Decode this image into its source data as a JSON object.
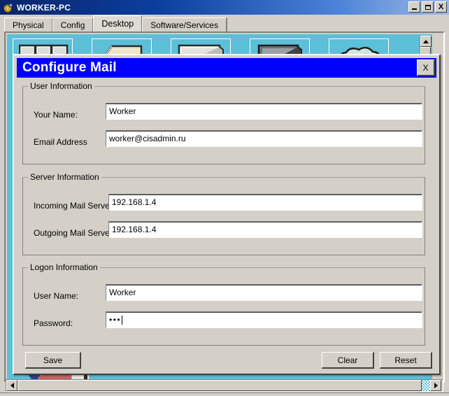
{
  "window": {
    "title": "WORKER-PC",
    "icon": "packet-tracer-device-icon",
    "controls": {
      "minimize": "_",
      "maximize": "□",
      "close": "X"
    }
  },
  "tabs": [
    {
      "label": "Physical",
      "active": false
    },
    {
      "label": "Config",
      "active": false
    },
    {
      "label": "Desktop",
      "active": true
    },
    {
      "label": "Software/Services",
      "active": false
    }
  ],
  "desktop": {
    "background_color": "#5bc0d8",
    "icons": [
      {
        "name": "ip-configuration-icon"
      },
      {
        "name": "dial-up-icon"
      },
      {
        "name": "terminal-icon"
      },
      {
        "name": "command-prompt-icon"
      },
      {
        "name": "web-browser-icon"
      }
    ]
  },
  "dialog": {
    "title": "Configure Mail",
    "title_bg": "#0000ff",
    "close_label": "X",
    "groups": [
      {
        "legend": "User Information",
        "fields": [
          {
            "label": "Your Name:",
            "value": "Worker",
            "type": "text",
            "name": "your-name"
          },
          {
            "label": "Email Address",
            "value": "worker@cisadmin.ru",
            "type": "text",
            "name": "email-address"
          }
        ]
      },
      {
        "legend": "Server Information",
        "fields": [
          {
            "label": "Incoming Mail Server",
            "value": "192.168.1.4",
            "type": "text",
            "name": "incoming-mail-server"
          },
          {
            "label": "Outgoing Mail Server",
            "value": "192.168.1.4",
            "type": "text",
            "name": "outgoing-mail-server"
          }
        ]
      },
      {
        "legend": "Logon Information",
        "fields": [
          {
            "label": "User Name:",
            "value": "Worker",
            "type": "text",
            "name": "user-name"
          },
          {
            "label": "Password:",
            "value": "•••",
            "type": "password",
            "name": "password"
          }
        ]
      }
    ],
    "buttons": {
      "save": "Save",
      "clear": "Clear",
      "reset": "Reset"
    }
  }
}
